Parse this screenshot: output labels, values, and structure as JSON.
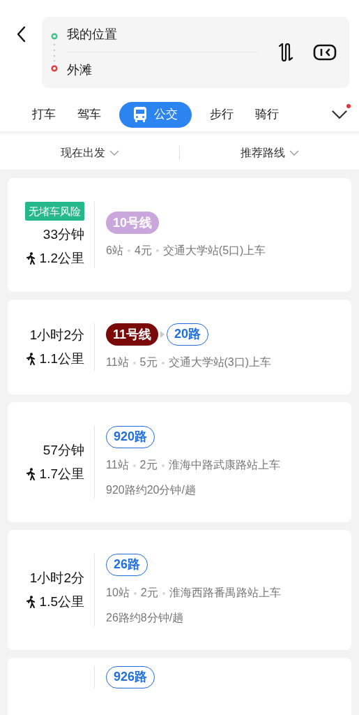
{
  "route": {
    "origin": "我的位置",
    "destination": "外滩"
  },
  "tabs": [
    {
      "label": "打车",
      "selected": false
    },
    {
      "label": "驾车",
      "selected": false
    },
    {
      "label": "公交",
      "selected": true
    },
    {
      "label": "步行",
      "selected": false
    },
    {
      "label": "骑行",
      "selected": false
    }
  ],
  "more_tabs": {
    "has_notification": true
  },
  "filters": [
    {
      "label": "现在出发"
    },
    {
      "label": "推荐路线"
    }
  ],
  "routes": [
    {
      "tag": "无堵车风险",
      "duration": "33分钟",
      "walk": "1.2公里",
      "lines": [
        {
          "name": "10号线",
          "kind": "metro",
          "color": "#c9a6dc"
        }
      ],
      "details": [
        "6站",
        "4元",
        "交通大学站(5口)上车"
      ]
    },
    {
      "duration": "1小时2分",
      "walk": "1.1公里",
      "lines": [
        {
          "name": "11号线",
          "kind": "metro",
          "color": "#7a0a0a"
        },
        {
          "name": "20路",
          "kind": "bus",
          "color": "#1f6fe0"
        }
      ],
      "details": [
        "11站",
        "5元",
        "交通大学站(3口)上车"
      ]
    },
    {
      "duration": "57分钟",
      "walk": "1.7公里",
      "lines": [
        {
          "name": "920路",
          "kind": "bus",
          "color": "#1f6fe0"
        }
      ],
      "details": [
        "11站",
        "2元",
        "淮海中路武康路站上车"
      ],
      "frequency": "920路约20分钟/趟"
    },
    {
      "duration": "1小时2分",
      "walk": "1.5公里",
      "lines": [
        {
          "name": "26路",
          "kind": "bus",
          "color": "#1f6fe0"
        }
      ],
      "details": [
        "10站",
        "2元",
        "淮海西路番禺路站上车"
      ],
      "frequency": "26路约8分钟/趟"
    },
    {
      "lines": [
        {
          "name": "926路",
          "kind": "bus",
          "color": "#1f6fe0"
        }
      ]
    }
  ]
}
